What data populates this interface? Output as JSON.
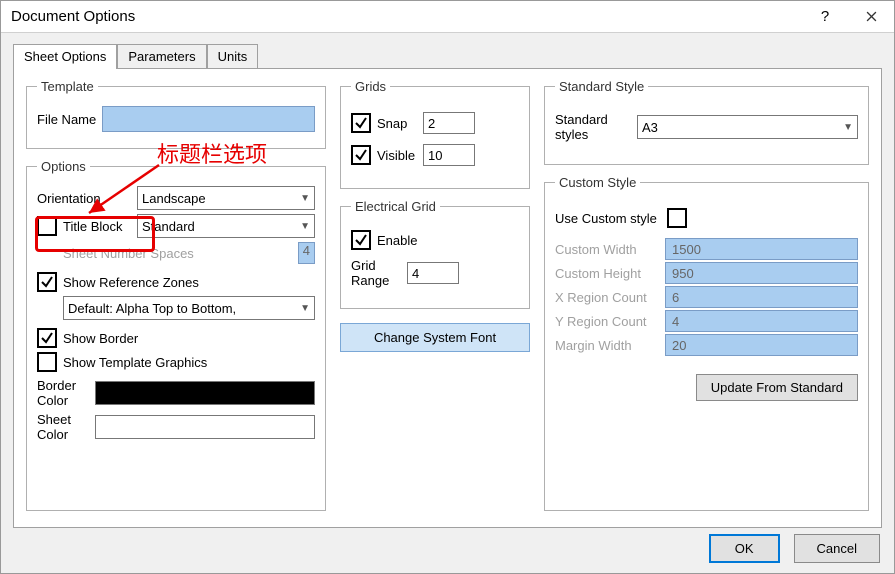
{
  "window": {
    "title": "Document Options"
  },
  "tabs": {
    "t0": "Sheet Options",
    "t1": "Parameters",
    "t2": "Units"
  },
  "template": {
    "legend": "Template",
    "fileNameLabel": "File Name",
    "fileName": ""
  },
  "options": {
    "legend": "Options",
    "orientationLabel": "Orientation",
    "orientation": "Landscape",
    "titleBlockLabel": "Title Block",
    "titleBlock": "Standard",
    "sheetNumSpacesLabel": "Sheet Number Spaces",
    "sheetNumSpaces": "4",
    "showRefZones": "Show Reference Zones",
    "refZonesMode": "Default: Alpha Top to Bottom,",
    "showBorder": "Show Border",
    "showTemplateGraphics": "Show Template Graphics",
    "borderColorLabel": "Border Color",
    "sheetColorLabel": "Sheet Color"
  },
  "grids": {
    "legend": "Grids",
    "snapLabel": "Snap",
    "snap": "2",
    "visibleLabel": "Visible",
    "visible": "10"
  },
  "egrid": {
    "legend": "Electrical Grid",
    "enableLabel": "Enable",
    "gridRangeLabel": "Grid Range",
    "gridRange": "4"
  },
  "font": {
    "change": "Change System Font"
  },
  "stdStyle": {
    "legend": "Standard Style",
    "stylesLabel": "Standard styles",
    "value": "A3"
  },
  "custStyle": {
    "legend": "Custom Style",
    "useLabel": "Use Custom style",
    "cwLabel": "Custom Width",
    "cw": "1500",
    "chLabel": "Custom Height",
    "ch": "950",
    "xrLabel": "X Region Count",
    "xr": "6",
    "yrLabel": "Y Region Count",
    "yr": "4",
    "mwLabel": "Margin Width",
    "mw": "20",
    "update": "Update From Standard"
  },
  "buttons": {
    "ok": "OK",
    "cancel": "Cancel"
  },
  "annotation": {
    "text": "标题栏选项"
  }
}
